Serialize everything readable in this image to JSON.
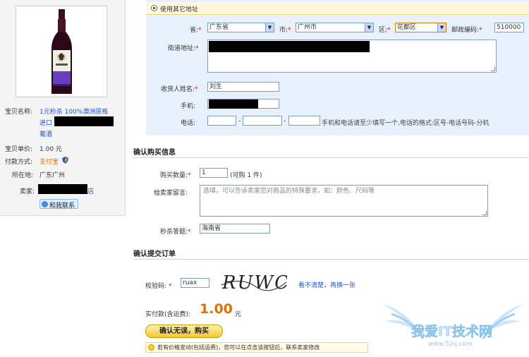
{
  "product": {
    "name_label": "宝贝名称:",
    "name_link_line1": "1元秒杀 100%澳洲原瓶",
    "name_link_line2": "进口",
    "name_link_line3": "葡酒",
    "price_label": "宝贝单价:",
    "price_value": "1.00 元",
    "payment_label": "付款方式:",
    "payment_value": "支付宝",
    "location_label": "所在地:",
    "location_value": "广东广州",
    "seller_label": "卖家:",
    "seller_suffix": "店",
    "contact_button": "和我联系"
  },
  "address": {
    "use_other_address": "使用其它地址",
    "province_label": "省:",
    "province_value": "广东省",
    "city_label": "市:",
    "city_value": "广州市",
    "district_label": "区:",
    "district_value": "花都区",
    "postcode_label": "邮政编码:",
    "postcode_value": "510000",
    "street_label": "街道地址:",
    "recipient_label": "收货人姓名:",
    "recipient_value": "刘生",
    "mobile_label": "手机:",
    "phone_label": "电话:",
    "phone_hint": "手机和电话请至少填写一个,电话的格式:区号-电话号码-分机",
    "dash": "-"
  },
  "purchase": {
    "section_title": "确认购买信息",
    "quantity_label": "购买数量:",
    "quantity_value": "1",
    "quantity_note": "(可购 1 件)",
    "message_label": "给卖家留言:",
    "message_placeholder": "选填，可以告诉卖家您对商品的特殊要求，如：颜色、尺码等",
    "quiz_label": "秒杀答题:",
    "quiz_value": "海南省"
  },
  "submit": {
    "section_title": "确认提交订单",
    "captcha_label": "校验码:",
    "captcha_input": "ruax",
    "captcha_text": "RUWC",
    "captcha_refresh": "看不清楚，再换一张",
    "total_label": "实付款(含运费):",
    "total_amount": "1.00",
    "total_unit": "元",
    "confirm_button": "确认无误，购买",
    "notice": "若有价格变动(包括运费)，您可以在点击该按钮后，联系卖家修改"
  },
  "watermark": {
    "text": "我爱IT技术网",
    "url": "www.52ij.com"
  },
  "colors": {
    "link": "#2255cc",
    "required": "#ee0000",
    "total_amount": "#e07000",
    "address_bg": "#e8f1fb"
  }
}
